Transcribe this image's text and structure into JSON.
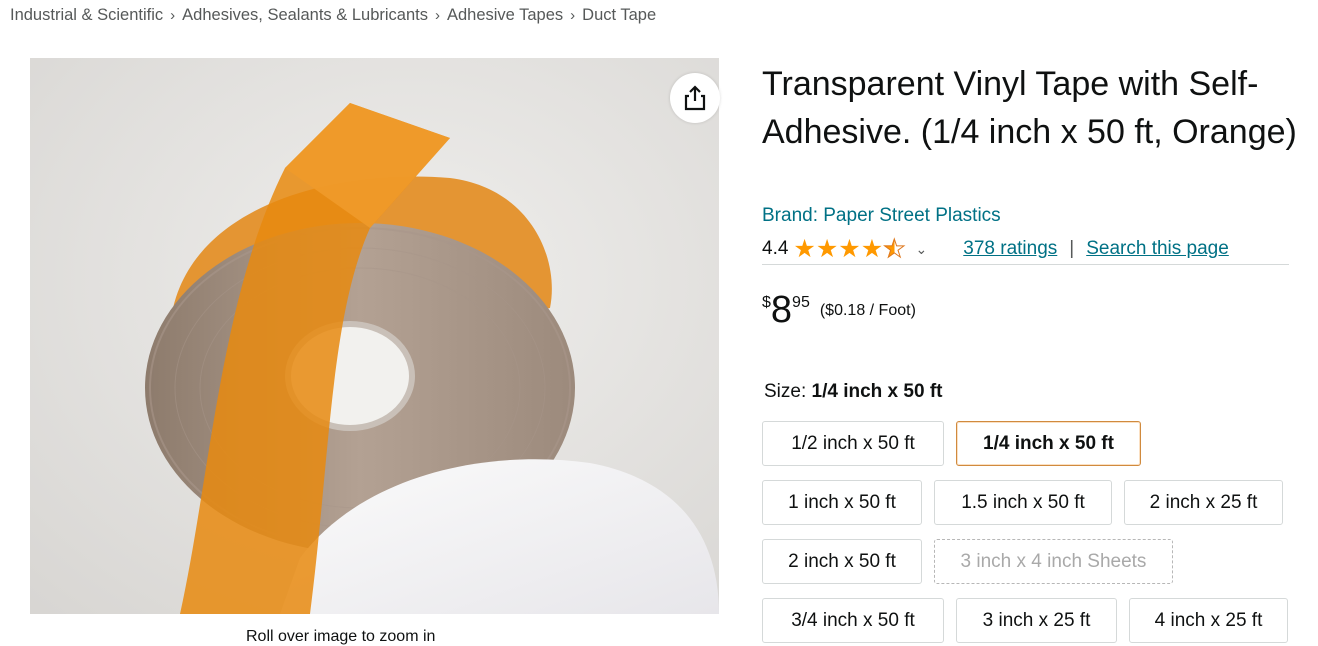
{
  "breadcrumb": [
    "Industrial & Scientific",
    "Adhesives, Sealants & Lubricants",
    "Adhesive Tapes",
    "Duct Tape"
  ],
  "breadcrumb_separator": "›",
  "image": {
    "caption": "Roll over image to zoom in",
    "share_icon": "share-icon"
  },
  "product": {
    "title": "Transparent Vinyl Tape with Self-Adhesive. (1/4 inch x 50 ft, Orange)",
    "brand": "Brand: Paper Street Plastics",
    "rating": "4.4",
    "ratings_count": "378 ratings",
    "pipe": "|",
    "search_page": "Search this page",
    "chevron": "⌄"
  },
  "price": {
    "symbol": "$",
    "whole": "8",
    "fraction": "95",
    "unit_price": "($0.18 / Foot)"
  },
  "size": {
    "label": "Size:",
    "selected": "1/4 inch x 50 ft",
    "options": [
      {
        "label": "1/2 inch x 50 ft",
        "state": "available"
      },
      {
        "label": "1/4 inch x 50 ft",
        "state": "selected"
      },
      {
        "label": "1 inch x 50 ft",
        "state": "available"
      },
      {
        "label": "1.5 inch x 50 ft",
        "state": "available"
      },
      {
        "label": "2 inch x 25 ft",
        "state": "available"
      },
      {
        "label": "2 inch x 50 ft",
        "state": "available"
      },
      {
        "label": "3 inch x 4 inch Sheets",
        "state": "unavailable"
      },
      {
        "label": "3/4 inch x 50 ft",
        "state": "available"
      },
      {
        "label": "3 inch x 25 ft",
        "state": "available"
      },
      {
        "label": "4 inch x 25 ft",
        "state": "available"
      }
    ]
  },
  "colors": {
    "link": "#007185",
    "star": "#ff9900",
    "selected_border": "#d08a3e",
    "tape": "#e8890f"
  }
}
